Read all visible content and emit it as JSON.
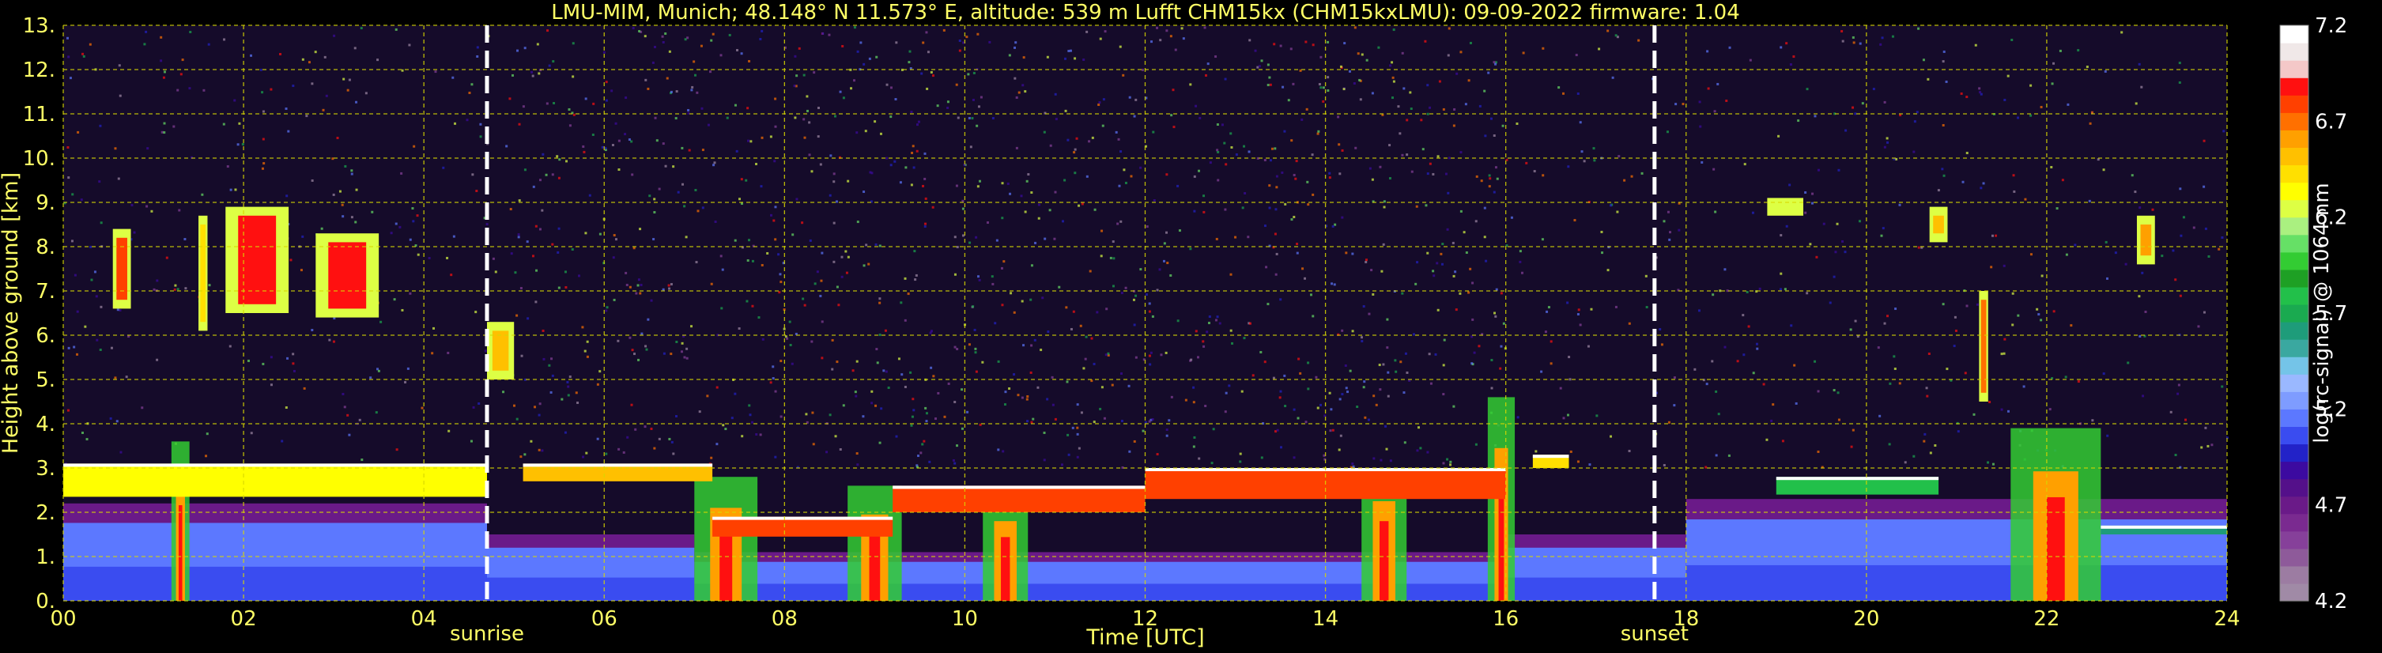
{
  "chart_data": {
    "type": "heatmap",
    "title": "LMU-MIM, Munich; 48.148° N 11.573° E, altitude: 539 m    Lufft CHM15kx (CHM15kxLMU): 09-09-2022    firmware: 1.04",
    "xlabel": "Time [UTC]",
    "ylabel": "Height above ground [km]",
    "xlim": [
      0,
      24
    ],
    "ylim": [
      0,
      13
    ],
    "x_ticks": [
      "00",
      "02",
      "04",
      "06",
      "08",
      "10",
      "12",
      "14",
      "16",
      "18",
      "20",
      "22",
      "24"
    ],
    "y_ticks": [
      "0.",
      "1.",
      "2.",
      "3.",
      "4.",
      "5.",
      "6.",
      "7.",
      "8.",
      "9.",
      "10.",
      "11.",
      "12.",
      "13."
    ],
    "grid": true,
    "events": [
      {
        "label": "sunrise",
        "time": 4.7
      },
      {
        "label": "sunset",
        "time": 17.65
      }
    ],
    "colorbar": {
      "label": "log(rc-signal) @ 1064 nm",
      "range": [
        4.2,
        7.2
      ],
      "ticks": [
        "4.2",
        "4.7",
        "5.2",
        "5.7",
        "6.2",
        "6.7",
        "7.2"
      ],
      "colors": [
        "#a08aa6",
        "#9c7ca2",
        "#8e5a9a",
        "#86409a",
        "#7a2a90",
        "#6a1a88",
        "#54108a",
        "#3c0aa0",
        "#2222c8",
        "#3a4cf0",
        "#5c78ff",
        "#7e9cff",
        "#9ab8ff",
        "#74c4e8",
        "#3aa8a0",
        "#1e9c7a",
        "#1aaa50",
        "#22c04a",
        "#1ea024",
        "#33cc33",
        "#66e066",
        "#aaf080",
        "#ddff44",
        "#ffff00",
        "#ffe000",
        "#ffc000",
        "#ffa000",
        "#ff7000",
        "#ff4000",
        "#ff1010",
        "#f4c8c8",
        "#f0e8e8",
        "#ffffff"
      ]
    },
    "cloud_layers": [
      {
        "t0": 0.0,
        "t1": 4.7,
        "h0": 2.35,
        "h1": 3.1,
        "intensity": 6.3
      },
      {
        "t0": 5.1,
        "t1": 7.2,
        "h0": 2.7,
        "h1": 3.1,
        "intensity": 6.5
      },
      {
        "t0": 7.2,
        "t1": 9.2,
        "h0": 1.45,
        "h1": 1.9,
        "intensity": 6.8
      },
      {
        "t0": 9.2,
        "t1": 12.0,
        "h0": 2.0,
        "h1": 2.6,
        "intensity": 6.8
      },
      {
        "t0": 12.0,
        "t1": 16.0,
        "h0": 2.3,
        "h1": 3.0,
        "intensity": 6.8
      },
      {
        "t0": 16.3,
        "t1": 16.7,
        "h0": 3.0,
        "h1": 3.3,
        "intensity": 6.4
      },
      {
        "t0": 19.0,
        "t1": 20.8,
        "h0": 2.4,
        "h1": 2.8,
        "intensity": 5.8
      },
      {
        "t0": 22.6,
        "t1": 24.0,
        "h0": 1.5,
        "h1": 1.7,
        "intensity": 5.6
      }
    ],
    "cirrus": [
      {
        "t0": 0.55,
        "t1": 0.75,
        "h0": 6.6,
        "h1": 8.4,
        "intensity": 6.8
      },
      {
        "t0": 1.5,
        "t1": 1.6,
        "h0": 6.1,
        "h1": 8.7,
        "intensity": 6.4
      },
      {
        "t0": 1.8,
        "t1": 2.5,
        "h0": 6.5,
        "h1": 8.9,
        "intensity": 6.9
      },
      {
        "t0": 2.8,
        "t1": 3.5,
        "h0": 6.4,
        "h1": 8.3,
        "intensity": 6.9
      },
      {
        "t0": 4.7,
        "t1": 5.0,
        "h0": 5.0,
        "h1": 6.3,
        "intensity": 6.5
      },
      {
        "t0": 18.9,
        "t1": 19.3,
        "h0": 8.7,
        "h1": 9.1,
        "intensity": 6.7
      },
      {
        "t0": 20.7,
        "t1": 20.9,
        "h0": 8.1,
        "h1": 8.9,
        "intensity": 6.5
      },
      {
        "t0": 21.25,
        "t1": 21.35,
        "h0": 4.5,
        "h1": 7.0,
        "intensity": 6.7
      },
      {
        "t0": 23.0,
        "t1": 23.2,
        "h0": 7.6,
        "h1": 8.7,
        "intensity": 6.6
      }
    ],
    "boundary_layer": [
      {
        "t0": 0.0,
        "t1": 4.7,
        "top": 2.2
      },
      {
        "t0": 4.7,
        "t1": 7.0,
        "top": 1.5
      },
      {
        "t0": 7.0,
        "t1": 16.0,
        "top": 1.1
      },
      {
        "t0": 16.0,
        "t1": 18.0,
        "top": 1.5
      },
      {
        "t0": 18.0,
        "t1": 24.0,
        "top": 2.3
      }
    ],
    "precipitation_streaks": [
      {
        "t0": 1.2,
        "t1": 1.4,
        "h_top": 3.6
      },
      {
        "t0": 7.0,
        "t1": 7.7,
        "h_top": 2.8
      },
      {
        "t0": 8.7,
        "t1": 9.3,
        "h_top": 2.6
      },
      {
        "t0": 10.2,
        "t1": 10.7,
        "h_top": 2.4
      },
      {
        "t0": 14.4,
        "t1": 14.9,
        "h_top": 3.0
      },
      {
        "t0": 15.8,
        "t1": 16.1,
        "h_top": 4.6
      },
      {
        "t0": 21.6,
        "t1": 22.6,
        "h_top": 3.9
      }
    ]
  }
}
